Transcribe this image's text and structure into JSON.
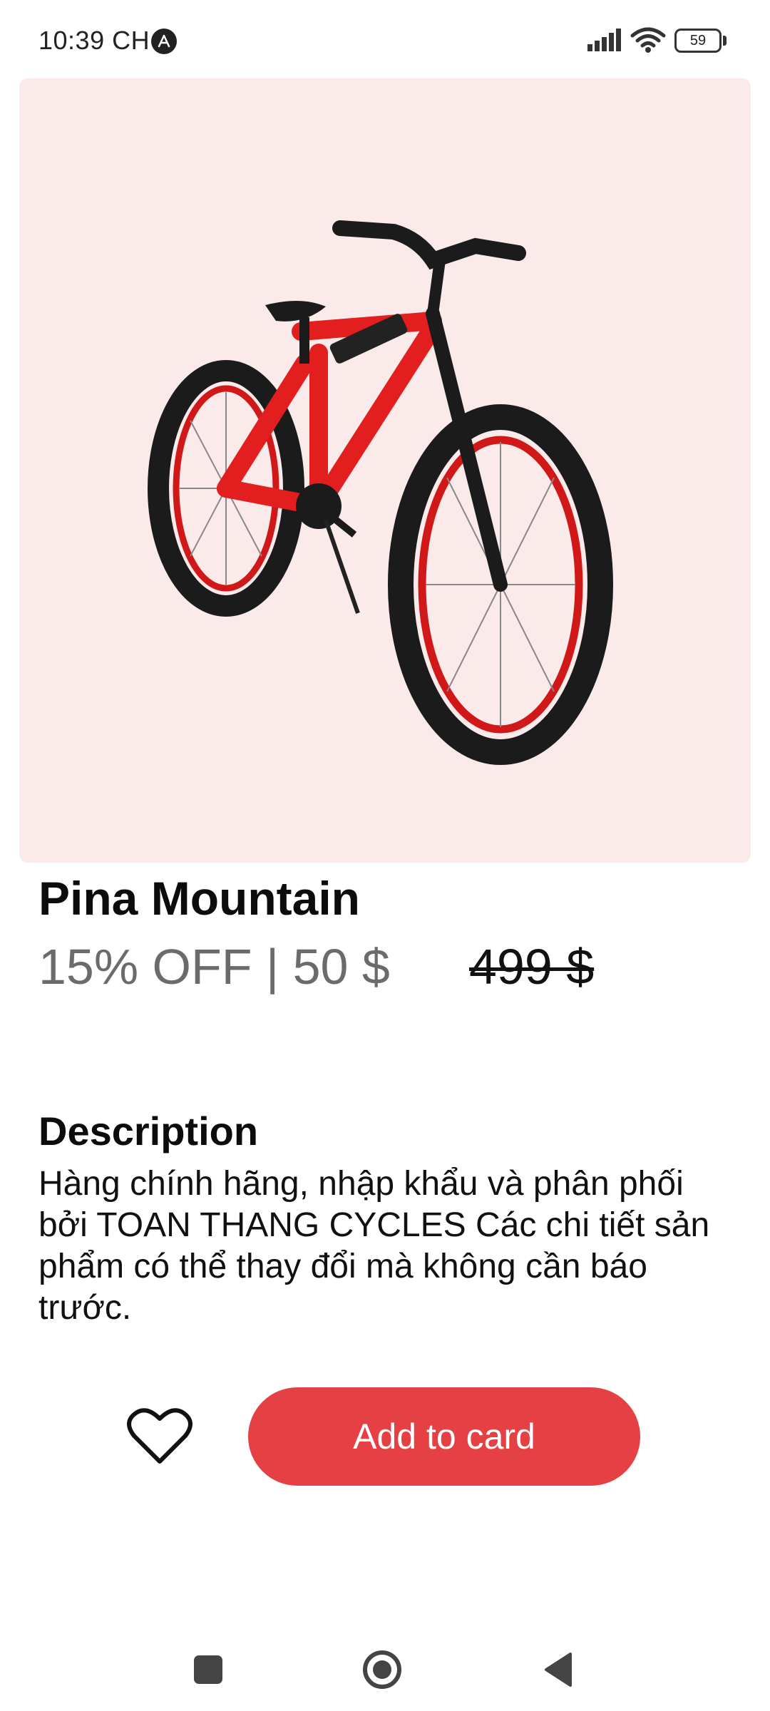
{
  "status_bar": {
    "time": "10:39 CH",
    "app_icon": "adobe-acrobat-icon",
    "battery": "59"
  },
  "product": {
    "image_icon": "red-bicycle-image",
    "title": "Pina Mountain",
    "discount_price": "15% OFF | 50 $",
    "original_price": "499 $"
  },
  "description": {
    "heading": "Description",
    "body": "Hàng chính hãng, nhập khẩu và phân phối bởi TOAN THANG CYCLES Các chi tiết sản phẩm có thể thay đổi mà không cần báo trước."
  },
  "actions": {
    "favorite_icon": "heart-outline-icon",
    "add_label": "Add to card"
  },
  "colors": {
    "accent": "#e54144",
    "image_background": "#fbeaea",
    "muted_text": "#6b6b6b"
  }
}
